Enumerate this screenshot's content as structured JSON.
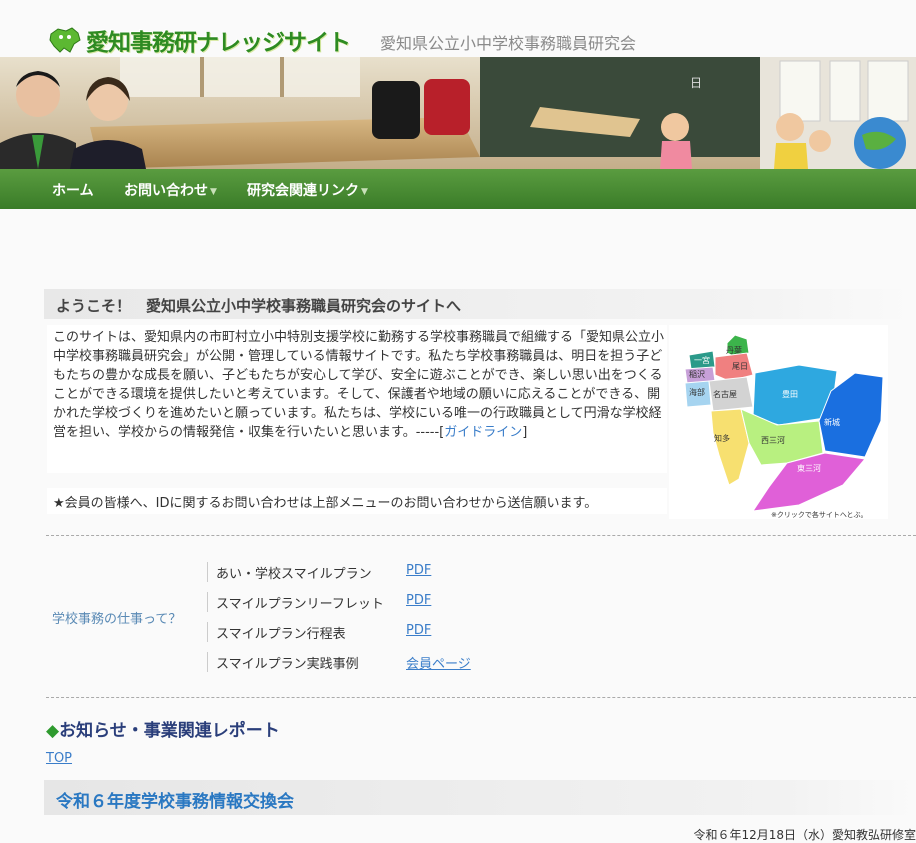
{
  "site": {
    "logo_text": "愛知事務研ナレッジサイト",
    "tagline": "愛知県公立小中学校事務職員研究会"
  },
  "nav": {
    "items": [
      {
        "label": "ホーム",
        "has_dropdown": false
      },
      {
        "label": "お問い合わせ",
        "has_dropdown": true
      },
      {
        "label": "研究会関連リンク",
        "has_dropdown": true
      }
    ]
  },
  "welcome": {
    "title": "ようこそ！　愛知県公立小中学校事務職員研究会のサイトへ",
    "intro_text": "このサイトは、愛知県内の市町村立小中特別支援学校に勤務する学校事務職員で組織する「愛知県公立小中学校事務職員研究会」が公開・管理している情報サイトです。私たち学校事務職員は、明日を担う子どもたちの豊かな成長を願い、子どもたちが安心して学び、安全に遊ぶことができ、楽しい思い出をつくることができる環境を提供したいと考えています。そして、保護者や地域の願いに応えることができる、開かれた学校づくりを進めたいと願っています。私たちは、学校にいる唯一の行政職員として円滑な学校経営を担い、学校からの情報発信・収集を行いたいと思います。",
    "intro_suffix": "-----[",
    "guideline_link": "ガイドライン",
    "intro_close": "]",
    "notice": "★会員の皆様へ、IDに関するお問い合わせは上部メニューのお問い合わせから送信願います。"
  },
  "map": {
    "regions": [
      "丹葉",
      "一宮",
      "尾張",
      "稲沢",
      "海部",
      "名古屋",
      "尾日",
      "豊田",
      "新城",
      "知多",
      "西三河",
      "東三河"
    ],
    "caption": "※クリックで各サイトへとぶ。",
    "colors": {
      "tanba": "#3cb44b",
      "ichinomiya": "#2b9a8a",
      "owari": "#f08080",
      "inazawa": "#c7a0d8",
      "kaibu": "#a6d4f0",
      "nagoya": "#d3d3d3",
      "obi": "#f4a0a0",
      "toyota": "#2ea8e0",
      "shinshiro": "#1a6fe0",
      "chita": "#f7e070",
      "nishimikawa": "#b8f080",
      "higashimikawa": "#e060d8"
    }
  },
  "work": {
    "label": "学校事務の仕事って？",
    "rows": [
      {
        "label": "あい・学校スマイルプラン",
        "link": "PDF"
      },
      {
        "label": "スマイルプランリーフレット",
        "link": "PDF"
      },
      {
        "label": "スマイルプラン行程表",
        "link": "PDF"
      },
      {
        "label": "スマイルプラン実践事例",
        "link": "会員ページ"
      }
    ]
  },
  "news": {
    "diamond": "◆",
    "title": "お知らせ・事業関連レポート",
    "top_link": "TOP",
    "event_title": "令和６年度学校事務情報交換会",
    "event_date": "令和６年12月18日（水）愛知教弘研修室"
  }
}
